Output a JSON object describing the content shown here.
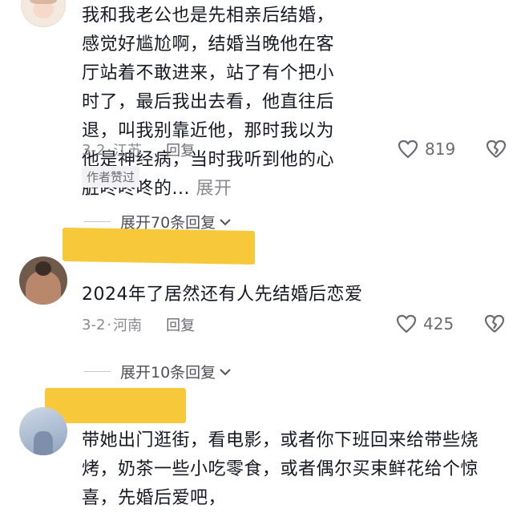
{
  "comments": [
    {
      "text": "我和我老公也是先相亲后结婚，感觉好尴尬啊，结婚当晚他在客厅站着不敢进来，站了有个把小时了，最后我出去看，他直往后退，叫我别靠近他，那时我以为他是神经病，当时我听到他的心脏咚咚咚的...",
      "expand": "展开",
      "date": "3-2",
      "location": "江苏",
      "reply": "回复",
      "likes": "819",
      "badge": "作者赞过",
      "expand_replies": "展开70条回复"
    },
    {
      "text": "2024年了居然还有人先结婚后恋爱",
      "date": "3-2",
      "location": "河南",
      "reply": "回复",
      "likes": "425",
      "expand_replies": "展开10条回复"
    },
    {
      "text": "带她出门逛街，看电影，或者你下班回来给带些烧烤，奶茶一些小吃零食，或者偶尔买束鲜花给个惊喜，先婚后爱吧，"
    }
  ],
  "colors": {
    "text": "#161823",
    "secondary": "#8a8a8f",
    "mask": "#f7c93a"
  },
  "separator": "·"
}
